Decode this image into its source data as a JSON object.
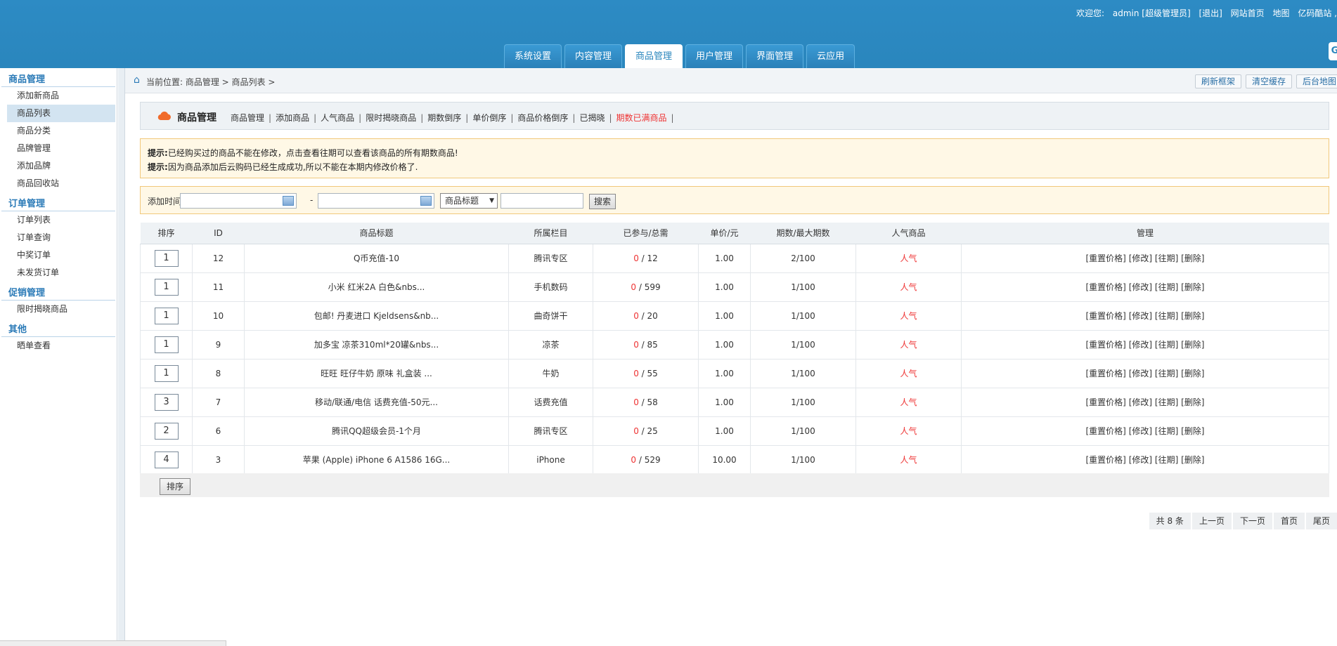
{
  "header": {
    "welcome": "欢迎您:",
    "user": "admin [超级管理员]",
    "logout": "[退出]",
    "home": "网站首页",
    "map": "地图",
    "brand": "亿码酷站 ,"
  },
  "tabs": [
    {
      "label": "系统设置"
    },
    {
      "label": "内容管理"
    },
    {
      "label": "商品管理",
      "active": true
    },
    {
      "label": "用户管理"
    },
    {
      "label": "界面管理"
    },
    {
      "label": "云应用"
    }
  ],
  "sidebar": {
    "groups": [
      {
        "title": "商品管理",
        "items": [
          "添加新商品",
          "商品列表",
          "商品分类",
          "品牌管理",
          "添加品牌",
          "商品回收站"
        ]
      },
      {
        "title": "订单管理",
        "items": [
          "订单列表",
          "订单查询",
          "中奖订单",
          "未发货订单"
        ]
      },
      {
        "title": "促销管理",
        "items": [
          "限时揭晓商品"
        ]
      },
      {
        "title": "其他",
        "items": [
          "晒单查看"
        ]
      }
    ],
    "active_item": "商品列表"
  },
  "breadcrumb": {
    "text": "当前位置: 商品管理 > 商品列表 >",
    "buttons": [
      "刷新框架",
      "清空缓存",
      "后台地图"
    ]
  },
  "panel": {
    "title": "商品管理",
    "links": [
      "商品管理",
      "添加商品",
      "人气商品",
      "限时揭晓商品",
      "期数倒序",
      "单价倒序",
      "商品价格倒序",
      "已揭晓",
      "期数已满商品"
    ]
  },
  "tips": [
    {
      "label": "提示:",
      "text": "已经购买过的商品不能在修改，点击查看往期可以查看该商品的所有期数商品!"
    },
    {
      "label": "提示:",
      "text": "因为商品添加后云购码已经生成成功,所以不能在本期内修改价格了."
    }
  ],
  "search": {
    "label": "添加时间:",
    "dash": "-",
    "select_value": "商品标题",
    "button": "搜索"
  },
  "table": {
    "headers": [
      "排序",
      "ID",
      "商品标题",
      "所属栏目",
      "已参与/总需",
      "单价/元",
      "期数/最大期数",
      "人气商品",
      "管理"
    ],
    "rows": [
      {
        "order": "1",
        "id": "12",
        "title": "Q币充值-10",
        "category": "腾讯专区",
        "joined": "0",
        "total": "12",
        "price": "1.00",
        "period": "2/100",
        "hot": "人气"
      },
      {
        "order": "1",
        "id": "11",
        "title": "小米 红米2A 白色&nbs...",
        "category": "手机数码",
        "joined": "0",
        "total": "599",
        "price": "1.00",
        "period": "1/100",
        "hot": "人气"
      },
      {
        "order": "1",
        "id": "10",
        "title": "包邮! 丹麦进口 Kjeldsens&nb...",
        "category": "曲奇饼干",
        "joined": "0",
        "total": "20",
        "price": "1.00",
        "period": "1/100",
        "hot": "人气"
      },
      {
        "order": "1",
        "id": "9",
        "title": "加多宝 凉茶310ml*20罐&nbs...",
        "category": "凉茶",
        "joined": "0",
        "total": "85",
        "price": "1.00",
        "period": "1/100",
        "hot": "人气"
      },
      {
        "order": "1",
        "id": "8",
        "title": "旺旺 旺仔牛奶 原味 礼盒装 ...",
        "category": "牛奶",
        "joined": "0",
        "total": "55",
        "price": "1.00",
        "period": "1/100",
        "hot": "人气"
      },
      {
        "order": "3",
        "id": "7",
        "title": "移动/联通/电信 话费充值-50元...",
        "category": "话费充值",
        "joined": "0",
        "total": "58",
        "price": "1.00",
        "period": "1/100",
        "hot": "人气"
      },
      {
        "order": "2",
        "id": "6",
        "title": "腾讯QQ超级会员-1个月",
        "category": "腾讯专区",
        "joined": "0",
        "total": "25",
        "price": "1.00",
        "period": "1/100",
        "hot": "人气"
      },
      {
        "order": "4",
        "id": "3",
        "title": "苹果 (Apple) iPhone 6 A1586 16G...",
        "category": "iPhone",
        "joined": "0",
        "total": "529",
        "price": "10.00",
        "period": "1/100",
        "hot": "人气"
      }
    ],
    "ops": [
      "[重置价格]",
      "[修改]",
      "[往期]",
      "[删除]"
    ]
  },
  "sort_button": "排序",
  "pager": [
    "共 8 条",
    "上一页",
    "下一页",
    "首页",
    "尾页"
  ],
  "colors": {
    "header_blue": "#2a86bd",
    "accent_red": "#e33333",
    "tip_bg": "#fff8e6"
  }
}
